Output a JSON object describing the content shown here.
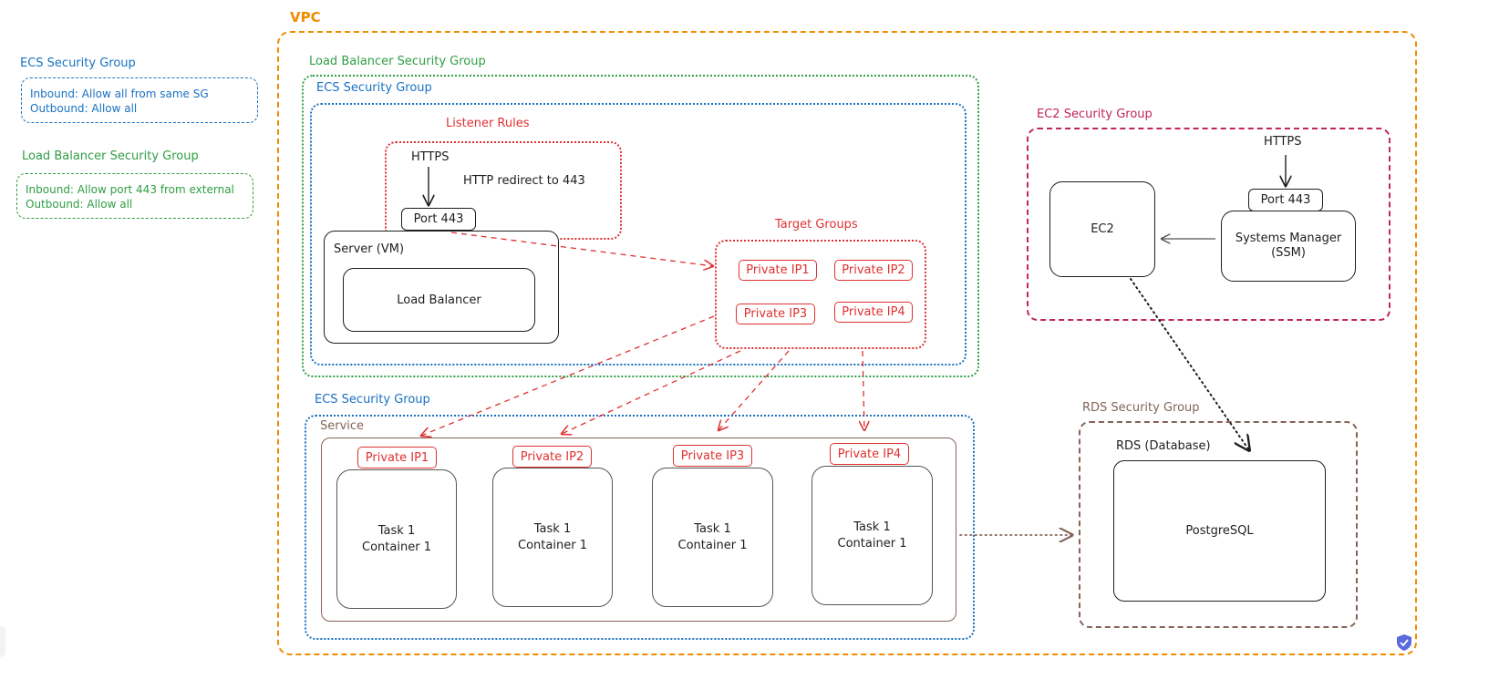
{
  "legend": {
    "ecs": {
      "title": "ECS Security Group",
      "inbound": "Inbound: Allow all from same SG",
      "outbound": "Outbound: Allow all"
    },
    "lb": {
      "title": "Load Balancer Security Group",
      "inbound": "Inbound: Allow port 443 from external",
      "outbound": "Outbound: Allow all"
    }
  },
  "vpc": {
    "title": "VPC",
    "lb_sg": {
      "title": "Load Balancer Security Group",
      "ecs_sg_title": "ECS Security Group",
      "listener_rules": {
        "title": "Listener Rules",
        "https": "HTTPS",
        "redirect": "HTTP redirect to 443"
      },
      "port": "Port 443",
      "server": {
        "title": "Server (VM)",
        "inner": "Load Balancer"
      },
      "target_groups": {
        "title": "Target Groups",
        "ips": [
          "Private IP1",
          "Private IP2",
          "Private IP3",
          "Private IP4"
        ]
      }
    },
    "ecs_sg2": {
      "title": "ECS Security Group",
      "service": {
        "title": "Service",
        "tasks": [
          {
            "ip": "Private IP1",
            "line1": "Task 1",
            "line2": "Container 1"
          },
          {
            "ip": "Private IP2",
            "line1": "Task 1",
            "line2": "Container 1"
          },
          {
            "ip": "Private IP3",
            "line1": "Task 1",
            "line2": "Container 1"
          },
          {
            "ip": "Private IP4",
            "line1": "Task 1",
            "line2": "Container 1"
          }
        ]
      }
    },
    "ec2_sg": {
      "title": "EC2 Security Group",
      "ec2": "EC2",
      "https": "HTTPS",
      "port": "Port 443",
      "ssm_line1": "Systems Manager",
      "ssm_line2": "(SSM)"
    },
    "rds_sg": {
      "title": "RDS Security Group",
      "rds_label": "RDS (Database)",
      "db": "PostgreSQL"
    }
  },
  "colors": {
    "vpc": "#f08c00",
    "lb_sg": "#2f9e44",
    "ecs_sg": "#1971c2",
    "listener": "#e03131",
    "ec2_sg": "#c2255c",
    "rds_sg": "#846358",
    "shield": "#5c6bdb"
  }
}
